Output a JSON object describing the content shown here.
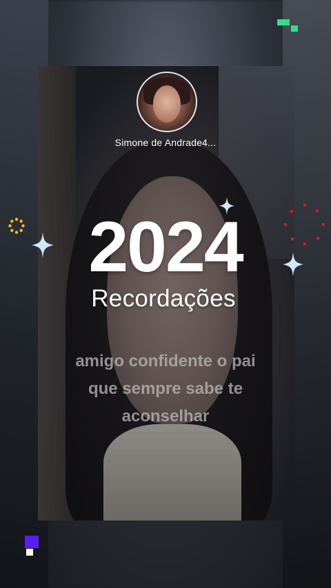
{
  "profile": {
    "username": "Simone de Andrade4..."
  },
  "overlay": {
    "year": "2024",
    "subtitle": "Recordações",
    "caption_lines": [
      "amigo confidente o pai",
      "que sempre sabe te",
      "aconselhar"
    ]
  },
  "colors": {
    "text": "#ffffff",
    "caption": "#bebaba",
    "sparkle": "#cfe9ff",
    "red_dots": "#e01818",
    "gold_ring": "#f2c21a",
    "pixel_green": "#2fe08a",
    "pixel_purple": "#5a1cff"
  },
  "icons": {
    "sparkle": "four-point-star",
    "ring": "dotted-circle",
    "pixel": "pixel-blocks"
  }
}
